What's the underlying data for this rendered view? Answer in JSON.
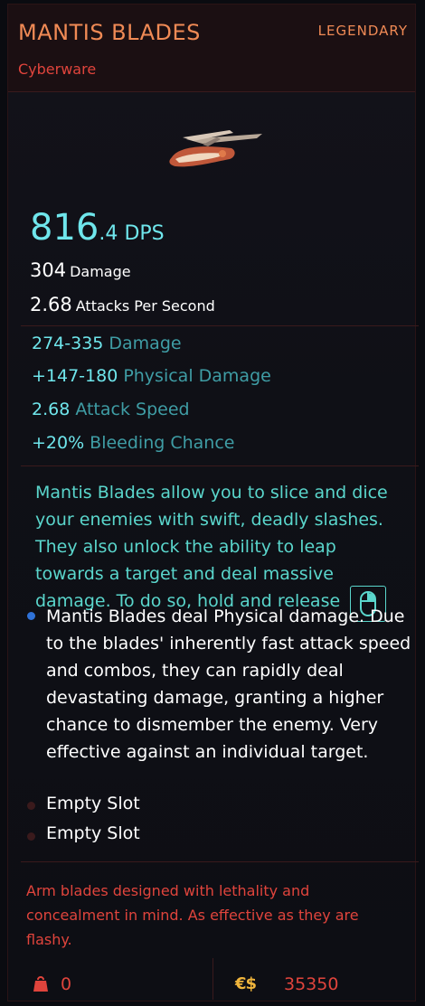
{
  "item": {
    "name": "MANTIS BLADES",
    "rarity": "LEGENDARY",
    "type": "Cyberware"
  },
  "dps": {
    "integer": "816",
    "decimal": ".4",
    "unit": "DPS"
  },
  "summary": {
    "damage_value": "304",
    "damage_label": "Damage",
    "aps_value": "2.68",
    "aps_label": "Attacks Per Second"
  },
  "stats": [
    {
      "value": "274-335",
      "label": "Damage"
    },
    {
      "value": "+147-180",
      "label": "Physical Damage"
    },
    {
      "value": "2.68",
      "label": "Attack Speed"
    },
    {
      "value": "+20%",
      "label": "Bleeding Chance"
    }
  ],
  "description": {
    "lines": [
      "Mantis Blades allow you to slice and dice",
      "your enemies with swift, deadly slashes.",
      "They also unlock the ability to leap",
      "towards a target and deal massive",
      "damage. To do so, hold and release"
    ],
    "icon": "mouse-right-click-icon"
  },
  "mod": {
    "lines": [
      "Mantis Blades deal Physical damage. Due",
      "to the blades' inherently fast attack speed",
      "and combos, they can rapidly deal",
      "devastating damage, granting a higher",
      "chance to dismember the enemy. Very",
      "effective against an individual target."
    ]
  },
  "slots": [
    "Empty Slot",
    "Empty Slot"
  ],
  "lore": {
    "lines": [
      "Arm blades designed with lethality and",
      "concealment in mind. As effective as they are",
      "flashy."
    ]
  },
  "footer": {
    "weight": "0",
    "price_symbol": "€$",
    "price": "35350"
  },
  "colors": {
    "accent_orange": "#f08a55",
    "accent_red": "#e0443c",
    "cyan": "#6fe6ec",
    "teal": "#5ad6cc",
    "mod_blue": "#2f72d8",
    "gold": "#f0b53c"
  }
}
